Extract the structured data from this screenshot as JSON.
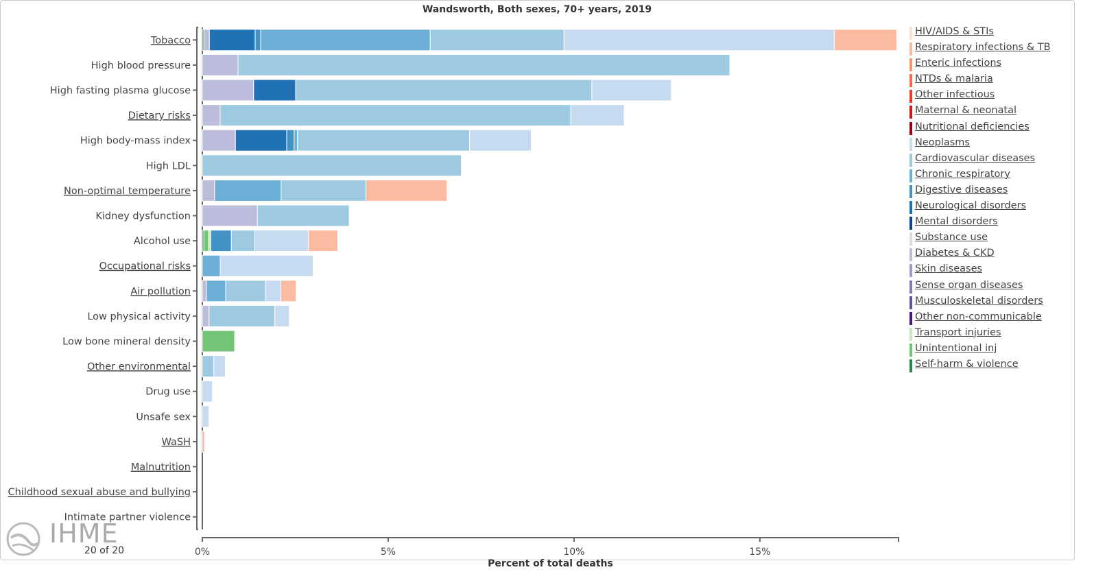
{
  "chart_data": {
    "type": "bar",
    "orientation": "horizontal-stacked",
    "title": "Wandsworth, Both sexes, 70+ years, 2019",
    "xlabel": "Percent of total deaths",
    "ylabel": "",
    "xlim": [
      0,
      18.73
    ],
    "xticks": [
      {
        "v": 0,
        "label": "0%"
      },
      {
        "v": 5,
        "label": "5%"
      },
      {
        "v": 10,
        "label": "10%"
      },
      {
        "v": 15,
        "label": "15%"
      }
    ],
    "legend_position": "right",
    "causes": [
      {
        "name": "HIV/AIDS & STIs",
        "color": "#fee0d2"
      },
      {
        "name": "Respiratory infections & TB",
        "color": "#fcbba1"
      },
      {
        "name": "Enteric infections",
        "color": "#fc9272"
      },
      {
        "name": "NTDs & malaria",
        "color": "#fb6a4a"
      },
      {
        "name": "Other infectious",
        "color": "#ef3b2c"
      },
      {
        "name": "Maternal & neonatal",
        "color": "#cb181d"
      },
      {
        "name": "Nutritional deficiencies",
        "color": "#99000d"
      },
      {
        "name": "Neoplasms",
        "color": "#c6dbef"
      },
      {
        "name": "Cardiovascular diseases",
        "color": "#9ecae1"
      },
      {
        "name": "Chronic respiratory",
        "color": "#6baed6"
      },
      {
        "name": "Digestive diseases",
        "color": "#4292c6"
      },
      {
        "name": "Neurological disorders",
        "color": "#2171b5"
      },
      {
        "name": "Mental disorders",
        "color": "#084594"
      },
      {
        "name": "Substance use",
        "color": "#dadaeb"
      },
      {
        "name": "Diabetes & CKD",
        "color": "#bcbddc"
      },
      {
        "name": "Skin diseases",
        "color": "#9e9ac8"
      },
      {
        "name": "Sense organ diseases",
        "color": "#807dba"
      },
      {
        "name": "Musculoskeletal disorders",
        "color": "#6a51a3"
      },
      {
        "name": "Other non-communicable",
        "color": "#4a1486"
      },
      {
        "name": "Transport injuries",
        "color": "#c7e9c0"
      },
      {
        "name": "Unintentional inj",
        "color": "#74c476"
      },
      {
        "name": "Self-harm & violence",
        "color": "#238b45"
      }
    ],
    "risks": [
      {
        "label": "Tobacco",
        "link": true,
        "segments": [
          [
            "Self-harm & violence",
            0.04
          ],
          [
            "Diabetes & CKD",
            0.15
          ],
          [
            "Neurological disorders",
            1.23
          ],
          [
            "Digestive diseases",
            0.15
          ],
          [
            "Chronic respiratory",
            4.56
          ],
          [
            "Cardiovascular diseases",
            3.6
          ],
          [
            "Neoplasms",
            7.27
          ],
          [
            "Respiratory infections & TB",
            1.68
          ]
        ]
      },
      {
        "label": "High blood pressure",
        "link": false,
        "segments": [
          [
            "Diabetes & CKD",
            0.96
          ],
          [
            "Cardiovascular diseases",
            13.23
          ]
        ]
      },
      {
        "label": "High fasting plasma glucose",
        "link": false,
        "segments": [
          [
            "Diabetes & CKD",
            1.38
          ],
          [
            "Neurological disorders",
            1.13
          ],
          [
            "Cardiovascular diseases",
            7.97
          ],
          [
            "Neoplasms",
            2.14
          ]
        ]
      },
      {
        "label": "Dietary risks",
        "link": true,
        "segments": [
          [
            "Diabetes & CKD",
            0.48
          ],
          [
            "Cardiovascular diseases",
            9.43
          ],
          [
            "Neoplasms",
            1.44
          ]
        ]
      },
      {
        "label": "High body-mass index",
        "link": false,
        "segments": [
          [
            "Diabetes & CKD",
            0.89
          ],
          [
            "Neurological disorders",
            1.38
          ],
          [
            "Digestive diseases",
            0.2
          ],
          [
            "Chronic respiratory",
            0.09
          ],
          [
            "Cardiovascular diseases",
            4.63
          ],
          [
            "Neoplasms",
            1.66
          ]
        ]
      },
      {
        "label": "High LDL",
        "link": false,
        "segments": [
          [
            "Cardiovascular diseases",
            6.97
          ]
        ]
      },
      {
        "label": "Non-optimal temperature",
        "link": true,
        "segments": [
          [
            "Diabetes & CKD",
            0.33
          ],
          [
            "Chronic respiratory",
            1.79
          ],
          [
            "Cardiovascular diseases",
            2.28
          ],
          [
            "Respiratory infections & TB",
            2.18
          ]
        ]
      },
      {
        "label": "Kidney dysfunction",
        "link": false,
        "segments": [
          [
            "Diabetes & CKD",
            1.48
          ],
          [
            "Cardiovascular diseases",
            2.47
          ]
        ]
      },
      {
        "label": "Alcohol use",
        "link": false,
        "segments": [
          [
            "Self-harm & violence",
            0.04
          ],
          [
            "Unintentional inj",
            0.13
          ],
          [
            "Transport injuries",
            0.06
          ],
          [
            "Digestive diseases",
            0.55
          ],
          [
            "Cardiovascular diseases",
            0.63
          ],
          [
            "Neoplasms",
            1.44
          ],
          [
            "Respiratory infections & TB",
            0.79
          ]
        ]
      },
      {
        "label": "Occupational risks",
        "link": true,
        "segments": [
          [
            "Chronic respiratory",
            0.48
          ],
          [
            "Neoplasms",
            2.5
          ]
        ]
      },
      {
        "label": "Air pollution",
        "link": true,
        "segments": [
          [
            "Diabetes & CKD",
            0.11
          ],
          [
            "Chronic respiratory",
            0.52
          ],
          [
            "Cardiovascular diseases",
            1.07
          ],
          [
            "Neoplasms",
            0.41
          ],
          [
            "Respiratory infections & TB",
            0.41
          ]
        ]
      },
      {
        "label": "Low physical activity",
        "link": false,
        "segments": [
          [
            "Diabetes & CKD",
            0.18
          ],
          [
            "Cardiovascular diseases",
            1.77
          ],
          [
            "Neoplasms",
            0.39
          ]
        ]
      },
      {
        "label": "Low bone mineral density",
        "link": false,
        "segments": [
          [
            "Unintentional inj",
            0.87
          ],
          [
            "Transport injuries",
            0.03
          ]
        ]
      },
      {
        "label": "Other environmental",
        "link": true,
        "segments": [
          [
            "Cardiovascular diseases",
            0.31
          ],
          [
            "Neoplasms",
            0.31
          ]
        ]
      },
      {
        "label": "Drug use",
        "link": false,
        "segments": [
          [
            "Neoplasms",
            0.27
          ]
        ]
      },
      {
        "label": "Unsafe sex",
        "link": false,
        "segments": [
          [
            "Neoplasms",
            0.18
          ]
        ]
      },
      {
        "label": "WaSH",
        "link": true,
        "segments": [
          [
            "Respiratory infections & TB",
            0.06
          ]
        ]
      },
      {
        "label": "Malnutrition",
        "link": true,
        "segments": []
      },
      {
        "label": "Childhood sexual abuse and bullying",
        "link": true,
        "segments": []
      },
      {
        "label": "Intimate partner violence",
        "link": false,
        "segments": []
      }
    ]
  },
  "footer": {
    "pagination": "20 of 20",
    "logo_text": "IHME"
  }
}
